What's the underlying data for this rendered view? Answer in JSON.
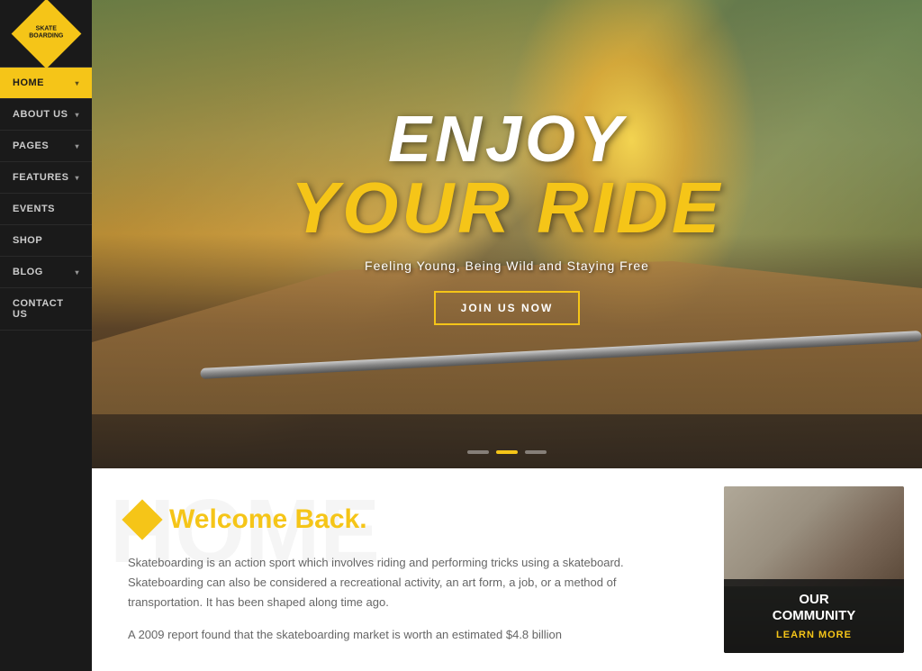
{
  "logo": {
    "line1": "SKATE",
    "line2": "BOARDING"
  },
  "nav": {
    "items": [
      {
        "id": "home",
        "label": "HOME",
        "hasDropdown": true,
        "active": true
      },
      {
        "id": "about",
        "label": "ABOUT US",
        "hasDropdown": true,
        "active": false
      },
      {
        "id": "pages",
        "label": "PAGES",
        "hasDropdown": true,
        "active": false
      },
      {
        "id": "features",
        "label": "FEATURES",
        "hasDropdown": true,
        "active": false
      },
      {
        "id": "events",
        "label": "EVENTS",
        "hasDropdown": false,
        "active": false
      },
      {
        "id": "shop",
        "label": "SHOP",
        "hasDropdown": false,
        "active": false
      },
      {
        "id": "blog",
        "label": "BLOG",
        "hasDropdown": true,
        "active": false
      },
      {
        "id": "contact",
        "label": "CONTACT US",
        "hasDropdown": false,
        "active": false
      }
    ]
  },
  "sidebar_label": "FeaTURES",
  "hero": {
    "title_line1": "ENJOY",
    "title_line2": "YOUR RIDE",
    "subtitle": "Feeling Young, Being Wild and Staying Free",
    "cta_label": "JOIN US NOW",
    "dots": [
      1,
      2,
      3
    ],
    "active_dot": 2
  },
  "welcome": {
    "title": "Welcome Back",
    "title_dot": ".",
    "paragraph1": "Skateboarding is an action sport which involves riding and performing tricks using a skateboard. Skateboarding can also be considered a recreational activity, an art form, a job, or a method of transportation. It has been shaped along time ago.",
    "paragraph2": "A 2009 report found that the skateboarding market is worth an estimated $4.8 billion"
  },
  "community": {
    "title": "OUR\nCOMMUNITY",
    "link_label": "LEARN MORE"
  },
  "colors": {
    "accent": "#f5c518",
    "dark": "#1a1a1a",
    "sidebar_bg": "#1a1a1a",
    "nav_active": "#f5c518"
  }
}
